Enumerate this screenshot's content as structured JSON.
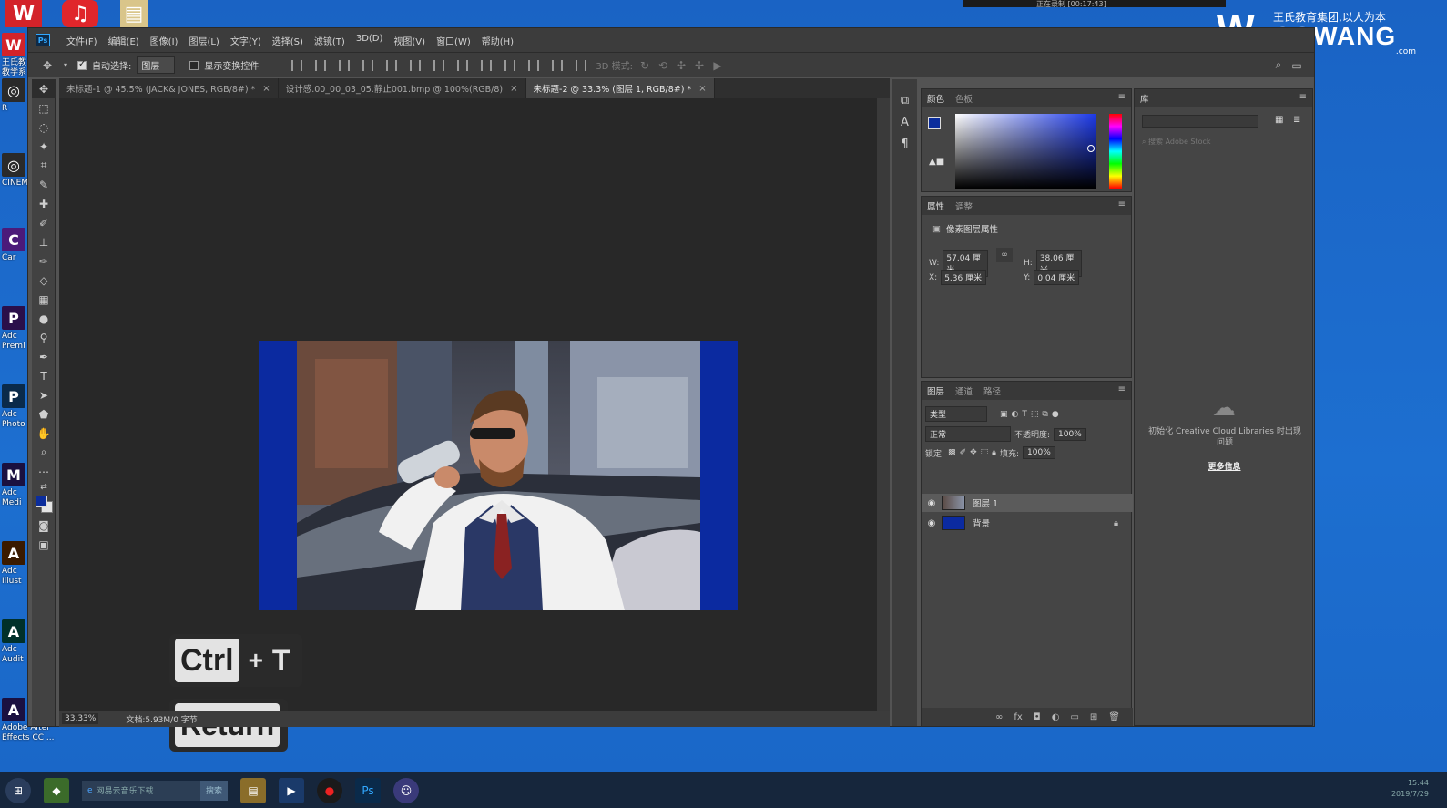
{
  "desktop": {
    "icons": [
      {
        "label": "王氏教\n教学系",
        "color": "#d3232a",
        "glyph": "W"
      },
      {
        "label": "R",
        "color": "#2a2a2a",
        "glyph": "◎"
      },
      {
        "label": "CINEM",
        "color": "#2a2a2a",
        "glyph": "◎"
      },
      {
        "label": "Car",
        "color": "#4b1a7a",
        "glyph": "C"
      },
      {
        "label": "Adc\nPremi",
        "color": "#2a0f4a",
        "glyph": "P"
      },
      {
        "label": "Adc\nPhoto",
        "color": "#0a2a4a",
        "glyph": "P"
      },
      {
        "label": "Adc\nMedi",
        "color": "#1a1040",
        "glyph": "M"
      },
      {
        "label": "Adc\nIllust",
        "color": "#3a1a00",
        "glyph": "A"
      },
      {
        "label": "Adc\nAudit",
        "color": "#00302a",
        "glyph": "A"
      },
      {
        "label": "Adobe After\nEffects CC ...",
        "color": "#1a1040",
        "glyph": "A"
      }
    ],
    "brand": {
      "tagline": "王氏教育集团,以人为本",
      "wordmark": "CGWANG",
      "domain": ".com",
      "logo_glyph": "W"
    },
    "recording_bar": "正在录制 [00:17:43]"
  },
  "menubar": {
    "items": [
      "文件(F)",
      "编辑(E)",
      "图像(I)",
      "图层(L)",
      "文字(Y)",
      "选择(S)",
      "滤镜(T)",
      "3D(D)",
      "视图(V)",
      "窗口(W)",
      "帮助(H)"
    ]
  },
  "options": {
    "auto_select_label": "自动选择:",
    "auto_select_value": "图层",
    "show_transform_label": "显示变换控件",
    "mode_3d_label": "3D 模式:"
  },
  "tabs": [
    {
      "label": "未标题-1 @ 45.5% (JACK& JONES, RGB/8#) *",
      "active": false
    },
    {
      "label": "设计感.00_00_03_05.静止001.bmp @ 100%(RGB/8)",
      "active": false
    },
    {
      "label": "未标题-2 @ 33.3% (图层 1, RGB/8#) *",
      "active": true
    }
  ],
  "status": {
    "zoom": "33.33%",
    "doc": "文档:5.93M/0 字节"
  },
  "keys": {
    "ctrl": "Ctrl",
    "plus": "+",
    "t": "T",
    "return": "Return"
  },
  "color_panel": {
    "tabs": [
      "颜色",
      "色板"
    ],
    "fg": "#0b2d9c",
    "bg": "#e5e5e5"
  },
  "props_panel": {
    "tabs": [
      "属性",
      "调整"
    ],
    "title": "像素图层属性",
    "w_label": "W:",
    "w": "57.04 厘米",
    "h_label": "H:",
    "h": "38.06 厘米",
    "x_label": "X:",
    "x": "5.36 厘米",
    "y_label": "Y:",
    "y": "0.04 厘米"
  },
  "layers_panel": {
    "tabs": [
      "图层",
      "通道",
      "路径"
    ],
    "filter": "类型",
    "blend_mode": "正常",
    "opacity_label": "不透明度:",
    "opacity": "100%",
    "lock_label": "锁定:",
    "fill_label": "填充:",
    "fill": "100%",
    "layers": [
      {
        "name": "图层 1",
        "selected": true,
        "thumb": "photo"
      },
      {
        "name": "背景",
        "selected": false,
        "thumb": "#0b2aa0",
        "locked": true
      }
    ]
  },
  "library_panel": {
    "tab": "库",
    "search_placeholder": "搜索 Adobe Stock",
    "message": "初始化 Creative Cloud Libraries 时出现问题",
    "more_info": "更多信息"
  },
  "taskbar": {
    "search_placeholder": "网易云音乐下载",
    "search_button": "搜索",
    "clock": "15:44",
    "date": "2019/7/29"
  }
}
